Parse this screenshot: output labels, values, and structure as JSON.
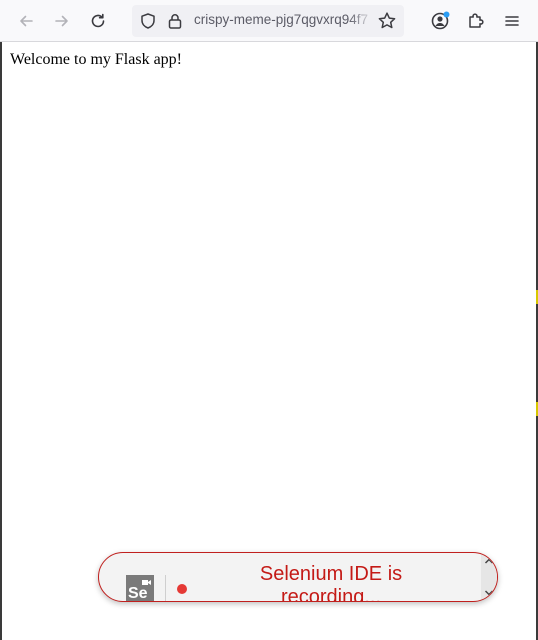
{
  "browser": {
    "url_text": "crispy-meme-pjg7qgvxrq94f7",
    "icons": {
      "back": "arrow-left-icon",
      "forward": "arrow-right-icon",
      "reload": "reload-icon",
      "tracking_protection": "shield-icon",
      "secure": "lock-icon",
      "bookmark": "star-icon",
      "account": "account-icon",
      "extensions": "puzzle-icon",
      "menu": "hamburger-menu-icon"
    },
    "account_badge_color": "#2a9df4"
  },
  "page": {
    "welcome_text": "Welcome to my Flask app!"
  },
  "selenium_ide": {
    "logo_text": "Se",
    "status_text": "Selenium IDE is recording...",
    "accent_color": "#c41a16",
    "dot_color": "#e53935"
  }
}
